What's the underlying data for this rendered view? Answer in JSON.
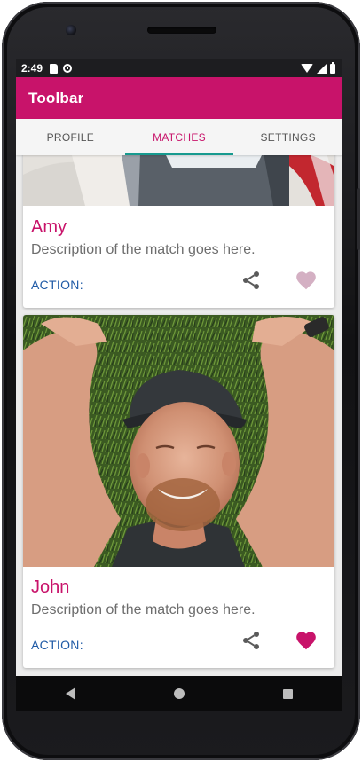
{
  "status_bar": {
    "time": "2:49"
  },
  "toolbar": {
    "title": "Toolbar"
  },
  "tabs": [
    {
      "label": "PROFILE",
      "active": false
    },
    {
      "label": "MATCHES",
      "active": true
    },
    {
      "label": "SETTINGS",
      "active": false
    }
  ],
  "cards": [
    {
      "name": "Amy",
      "description": "Description of the match goes here.",
      "action_label": "ACTION:",
      "favorited": false,
      "share_icon": "share-icon",
      "fav_icon": "heart-icon"
    },
    {
      "name": "John",
      "description": "Description of the match goes here.",
      "action_label": "ACTION:",
      "favorited": true,
      "share_icon": "share-icon",
      "fav_icon": "heart-icon"
    }
  ],
  "colors": {
    "primary": "#c8136a",
    "tab_indicator": "#179a8f",
    "action_text": "#1f5aa6",
    "heart_inactive": "#d4b0c3",
    "heart_active": "#c8136a"
  },
  "navigation": {
    "back": "back-icon",
    "home": "home-icon",
    "recents": "recents-icon"
  }
}
